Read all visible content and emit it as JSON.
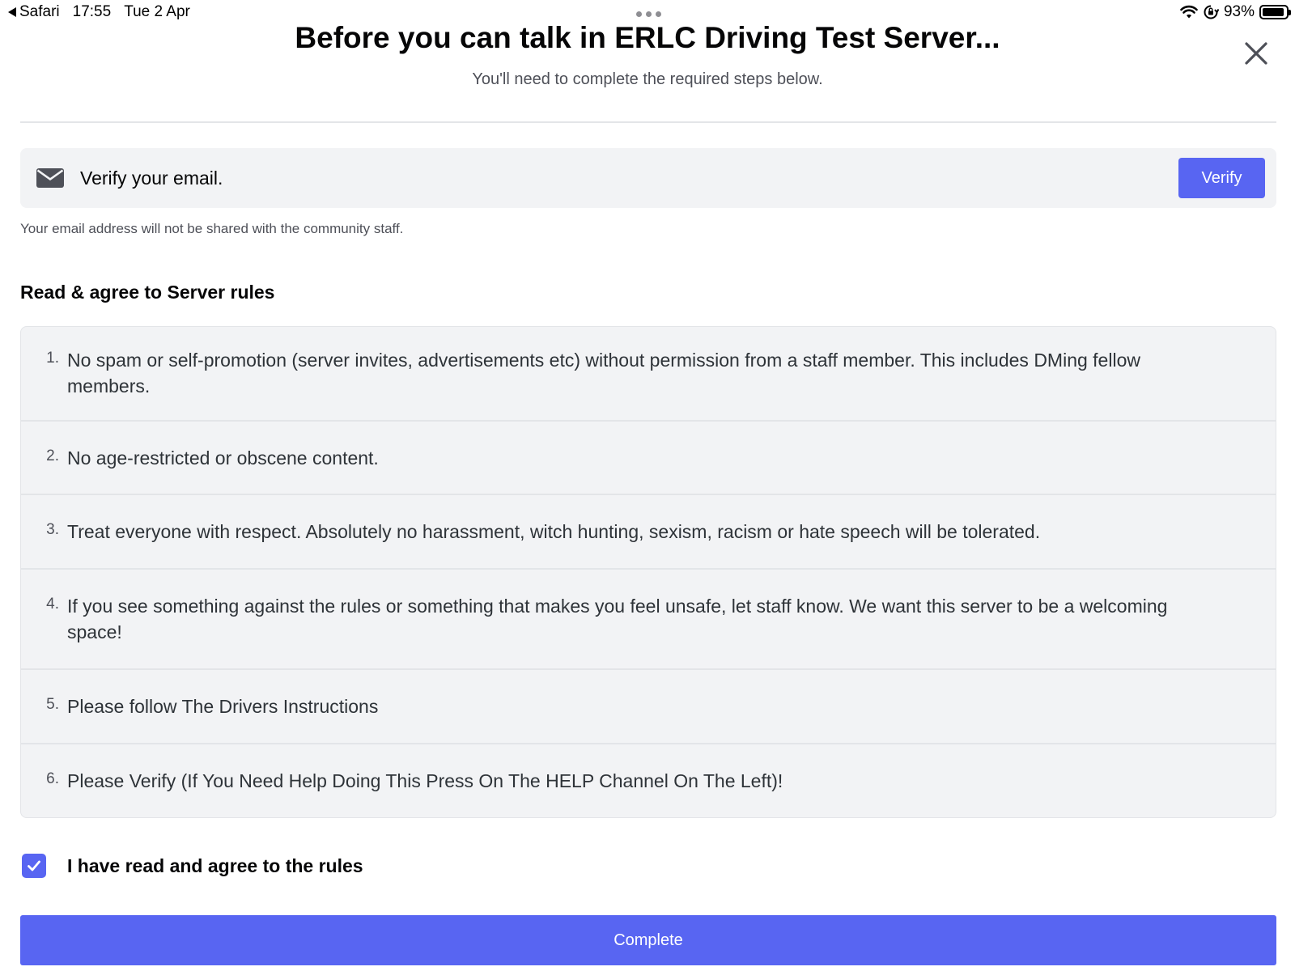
{
  "status_bar": {
    "back_app": "Safari",
    "time": "17:55",
    "date": "Tue 2 Apr",
    "battery": "93%",
    "battery_level": 0.93
  },
  "dialog": {
    "title": "Before you can talk in ERLC Driving Test Server...",
    "subtitle": "You'll need to complete the required steps below."
  },
  "verify_email": {
    "text": "Verify your email.",
    "button_label": "Verify",
    "note": "Your email address will not be shared with the community staff."
  },
  "rules": {
    "heading": "Read & agree to Server rules",
    "items": [
      {
        "num": "1.",
        "text": "No spam or self-promotion (server invites, advertisements etc) without permission from a staff member. This includes DMing fellow members."
      },
      {
        "num": "2.",
        "text": "No age-restricted or obscene content."
      },
      {
        "num": "3.",
        "text": "Treat everyone with respect. Absolutely no harassment, witch hunting, sexism, racism or hate speech will be tolerated."
      },
      {
        "num": "4.",
        "text": "If you see something against the rules or something that makes you feel unsafe, let staff know. We want this server to be a welcoming space!"
      },
      {
        "num": "5.",
        "text": "Please follow The Drivers Instructions"
      },
      {
        "num": "6.",
        "text": "Please Verify (If You Need Help Doing This Press On The HELP Channel On The Left)!"
      }
    ]
  },
  "agree": {
    "label": "I have read and agree to the rules",
    "checked": true
  },
  "complete_label": "Complete",
  "colors": {
    "accent": "#5865f2",
    "card_bg": "#f2f3f5"
  }
}
